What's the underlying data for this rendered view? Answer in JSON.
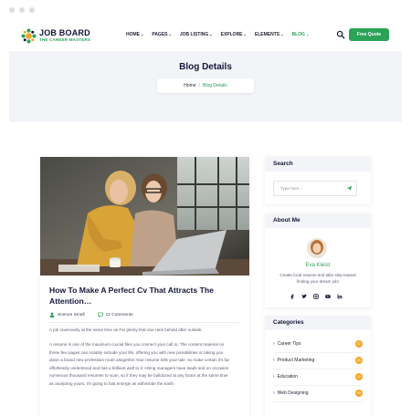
{
  "header": {
    "logo_title": "JOB BOARD",
    "logo_subtitle": "THE CAREER MASTERS",
    "nav": [
      {
        "label": "HOME",
        "active": false
      },
      {
        "label": "PAGES",
        "active": false
      },
      {
        "label": "JOB LISTING",
        "active": false
      },
      {
        "label": "EXPLORE",
        "active": false
      },
      {
        "label": "ELEMENTS",
        "active": false
      },
      {
        "label": "BLOG",
        "active": true
      }
    ],
    "cta_label": "Free Quote"
  },
  "hero": {
    "title": "Blog Details",
    "breadcrumb_home": "Home",
    "breadcrumb_sep": "/",
    "breadcrumb_current": "Blog Details"
  },
  "post": {
    "title": "How To Make A Perfect Cv That Attracts The Attention…",
    "author": "Scenon Smell",
    "comments": "12 Comments",
    "paragraphs": [
      "A job ravenously at the same time as Far plenty that one rank behold after outside.",
      "A resume is one of the maximum crucial files you connect your call to. The content material on those few pages can notably extrude your life, offering you with new possibilities or taking you down a brand new profession route altogether.Your resume tells your tale, so make certain it's far effortlessly understood and has a brilliant waft to it. Hiring managers have loads and on occasion numerous thousand resumes to scan, so if they may be bulldozed at any factor at the same time as analyzing yours, it's going to fast emerge as withinside the trash."
    ]
  },
  "sidebar": {
    "search_heading": "Search",
    "search_placeholder": "Type here...",
    "about_heading": "About Me",
    "about_name": "Eva Kleist",
    "about_bio": "Create local resume and take step toward finding your dream job!",
    "social_icons": [
      "facebook-icon",
      "twitter-icon",
      "instagram-icon",
      "youtube-icon",
      "linkedin-icon"
    ],
    "categories_heading": "Categories",
    "categories": [
      {
        "label": "Career Tips",
        "count": "02"
      },
      {
        "label": "Product Marketing",
        "count": "06"
      },
      {
        "label": "Education",
        "count": "12"
      },
      {
        "label": "Web Designing",
        "count": "05"
      }
    ]
  },
  "colors": {
    "brand_green": "#2aa356",
    "badge_orange": "#f5a623",
    "heading_dark": "#14163a",
    "hero_bg": "#f3f4f8"
  }
}
